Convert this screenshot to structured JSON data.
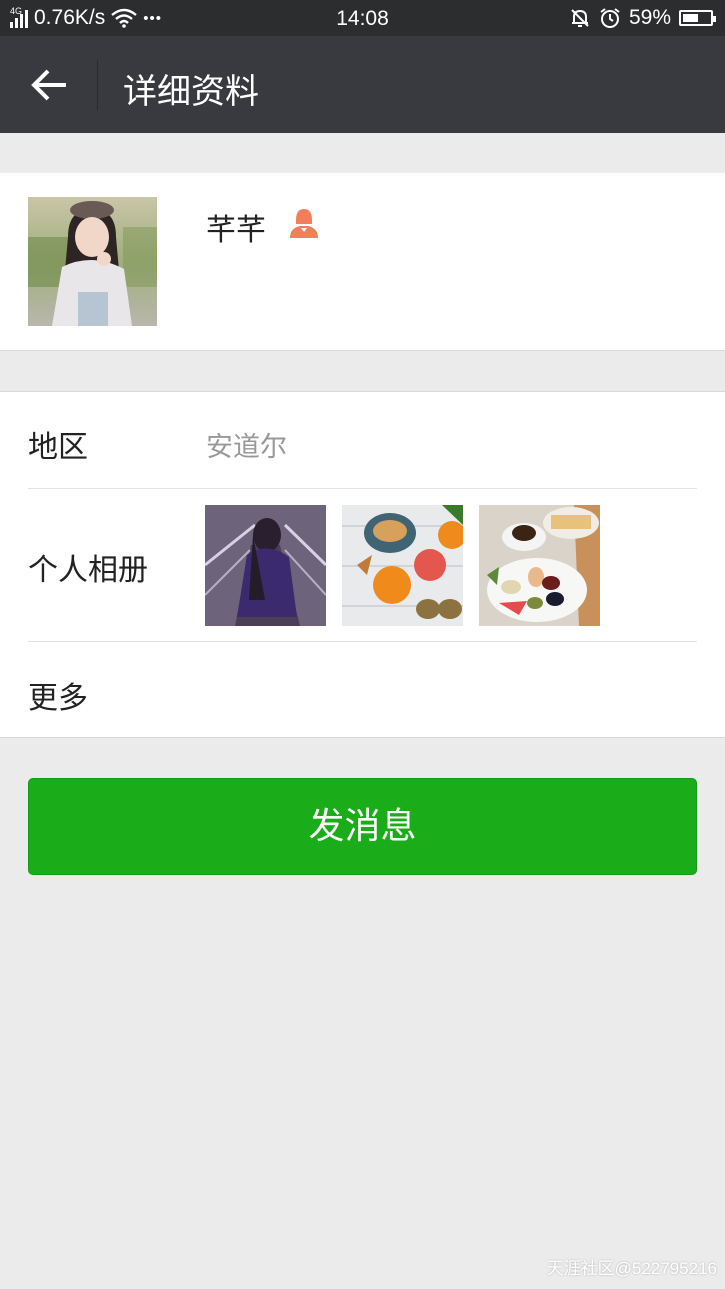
{
  "status_bar": {
    "network_type": "4G",
    "speed": "0.76K/s",
    "dots": "•••",
    "time": "14:08",
    "battery": "59%",
    "battery_level": 0.59
  },
  "header": {
    "title": "详细资料"
  },
  "profile": {
    "name": "芊芊",
    "gender_icon": "female-icon",
    "gender_color": "#f37e5b"
  },
  "info": {
    "region_label": "地区",
    "region_value": "安道尔",
    "album_label": "个人相册",
    "more_label": "更多"
  },
  "actions": {
    "send_label": "发消息",
    "send_color": "#1aad19"
  },
  "watermark": "天涯社区@522795216"
}
